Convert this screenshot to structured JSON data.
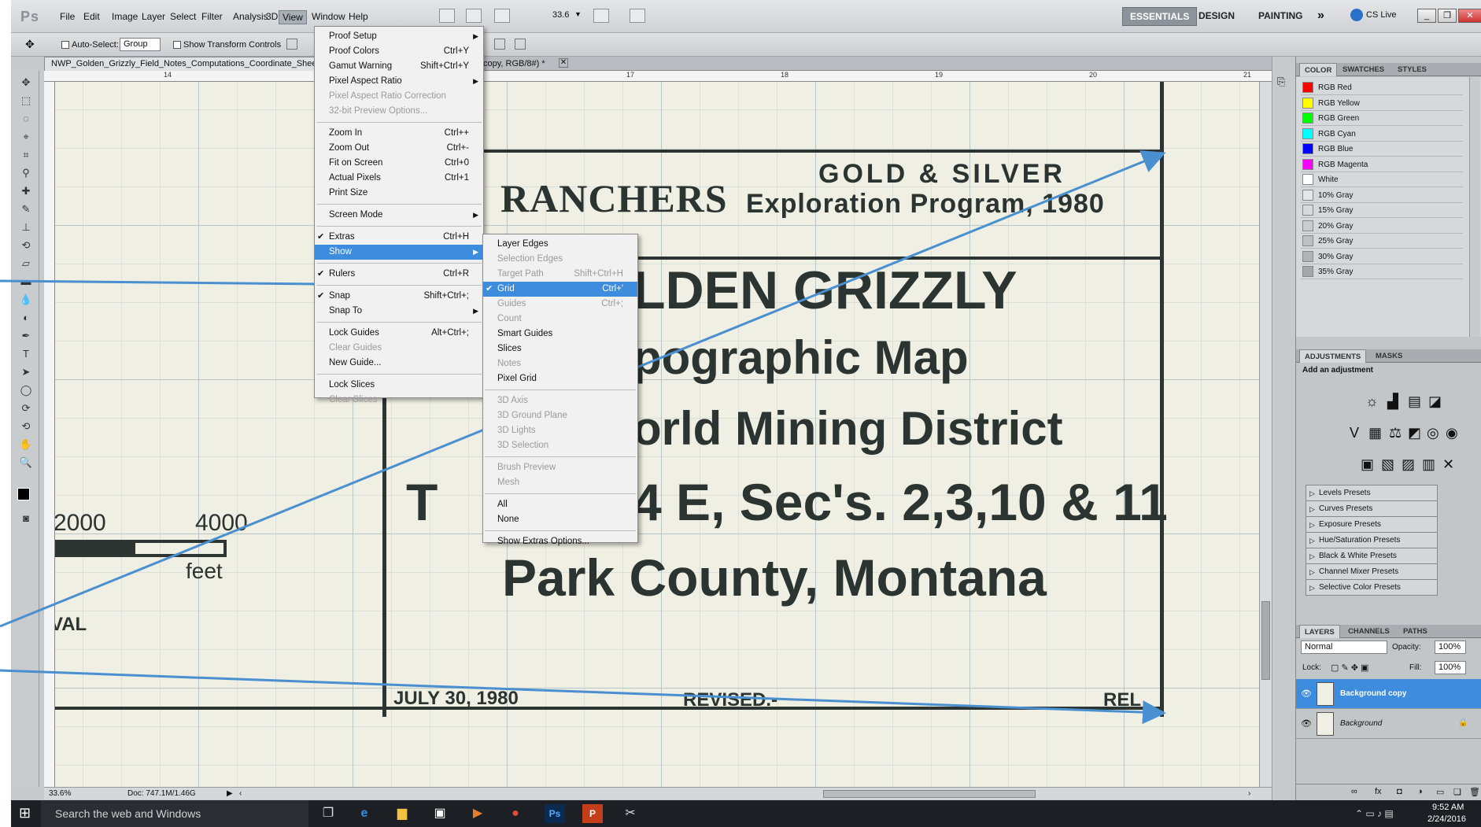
{
  "app": {
    "logo": "Ps"
  },
  "menubar": {
    "items": [
      "File",
      "Edit",
      "Image",
      "Layer",
      "Select",
      "Filter",
      "Analysis",
      "3D",
      "View",
      "Window",
      "Help"
    ],
    "zoom": "33.6",
    "workspaces": [
      "ESSENTIALS",
      "DESIGN",
      "PAINTING"
    ],
    "more": "»",
    "cslive": "CS Live"
  },
  "optionsbar": {
    "auto_select_label": "Auto-Select:",
    "auto_select_value": "Group",
    "show_transform": "Show Transform Controls"
  },
  "document": {
    "tab_title": "NWP_Golden_Grizzly_Field_Notes_Computations_Coordinate_Shee",
    "tab_suffix": "copy, RGB/8#) *",
    "ruler_numbers": [
      "14",
      "17",
      "18",
      "19",
      "20",
      "21"
    ],
    "map": {
      "gold_silver": "GOLD & SILVER",
      "ranchers": "RANCHERS",
      "exploration": "Exploration Program, 1980",
      "golden": "LDEN GRIZZLY",
      "topo": "pographic Map",
      "district": "orld Mining District",
      "sec": "4 E, Sec's. 2,3,10 & 11",
      "t": "T",
      "county": "Park County, Montana",
      "scale_2000": "2000",
      "scale_4000": "4000",
      "feet": "feet",
      "val": "VAL",
      "date": "JULY 30, 1980",
      "revised": "REVISED.-",
      "rel": "REL"
    }
  },
  "status": {
    "zoom": "33.6%",
    "doc": "Doc: 747.1M/1.46G"
  },
  "view_menu": {
    "items": [
      {
        "label": "Proof Setup",
        "shortcut": "",
        "arrow": true
      },
      {
        "label": "Proof Colors",
        "shortcut": "Ctrl+Y"
      },
      {
        "label": "Gamut Warning",
        "shortcut": "Shift+Ctrl+Y"
      },
      {
        "label": "Pixel Aspect Ratio",
        "shortcut": "",
        "arrow": true
      },
      {
        "label": "Pixel Aspect Ratio Correction",
        "shortcut": "",
        "disabled": true
      },
      {
        "label": "32-bit Preview Options...",
        "shortcut": "",
        "disabled": true
      },
      {
        "sep": true
      },
      {
        "label": "Zoom In",
        "shortcut": "Ctrl++"
      },
      {
        "label": "Zoom Out",
        "shortcut": "Ctrl+-"
      },
      {
        "label": "Fit on Screen",
        "shortcut": "Ctrl+0"
      },
      {
        "label": "Actual Pixels",
        "shortcut": "Ctrl+1"
      },
      {
        "label": "Print Size",
        "shortcut": ""
      },
      {
        "sep": true
      },
      {
        "label": "Screen Mode",
        "shortcut": "",
        "arrow": true
      },
      {
        "sep": true
      },
      {
        "label": "Extras",
        "shortcut": "Ctrl+H",
        "checked": true
      },
      {
        "label": "Show",
        "shortcut": "",
        "arrow": true,
        "highlight": true
      },
      {
        "sep": true
      },
      {
        "label": "Rulers",
        "shortcut": "Ctrl+R",
        "checked": true
      },
      {
        "sep": true
      },
      {
        "label": "Snap",
        "shortcut": "Shift+Ctrl+;",
        "checked": true
      },
      {
        "label": "Snap To",
        "shortcut": "",
        "arrow": true
      },
      {
        "sep": true
      },
      {
        "label": "Lock Guides",
        "shortcut": "Alt+Ctrl+;"
      },
      {
        "label": "Clear Guides",
        "shortcut": "",
        "disabled": true
      },
      {
        "label": "New Guide...",
        "shortcut": ""
      },
      {
        "sep": true
      },
      {
        "label": "Lock Slices",
        "shortcut": ""
      },
      {
        "label": "Clear Slices",
        "shortcut": "",
        "disabled": true
      }
    ]
  },
  "show_menu": {
    "items": [
      {
        "label": "Layer Edges",
        "shortcut": ""
      },
      {
        "label": "Selection Edges",
        "shortcut": "",
        "disabled": true
      },
      {
        "label": "Target Path",
        "shortcut": "Shift+Ctrl+H",
        "disabled": true
      },
      {
        "label": "Grid",
        "shortcut": "Ctrl+'",
        "checked": true,
        "highlight": true
      },
      {
        "label": "Guides",
        "shortcut": "Ctrl+;",
        "disabled": true
      },
      {
        "label": "Count",
        "shortcut": "",
        "disabled": true
      },
      {
        "label": "Smart Guides",
        "shortcut": ""
      },
      {
        "label": "Slices",
        "shortcut": ""
      },
      {
        "label": "Notes",
        "shortcut": "",
        "disabled": true
      },
      {
        "label": "Pixel Grid",
        "shortcut": ""
      },
      {
        "sep": true
      },
      {
        "label": "3D Axis",
        "shortcut": "",
        "disabled": true
      },
      {
        "label": "3D Ground Plane",
        "shortcut": "",
        "disabled": true
      },
      {
        "label": "3D Lights",
        "shortcut": "",
        "disabled": true
      },
      {
        "label": "3D Selection",
        "shortcut": "",
        "disabled": true
      },
      {
        "sep": true
      },
      {
        "label": "Brush Preview",
        "shortcut": "",
        "disabled": true
      },
      {
        "label": "Mesh",
        "shortcut": "",
        "disabled": true
      },
      {
        "sep": true
      },
      {
        "label": "All",
        "shortcut": ""
      },
      {
        "label": "None",
        "shortcut": ""
      },
      {
        "sep": true
      },
      {
        "label": "Show Extras Options...",
        "shortcut": ""
      }
    ]
  },
  "panels": {
    "color_tabs": [
      "COLOR",
      "SWATCHES",
      "STYLES"
    ],
    "swatches": [
      {
        "name": "RGB Red",
        "color": "#ff0000"
      },
      {
        "name": "RGB Yellow",
        "color": "#ffff00"
      },
      {
        "name": "RGB Green",
        "color": "#00ff00"
      },
      {
        "name": "RGB Cyan",
        "color": "#00ffff"
      },
      {
        "name": "RGB Blue",
        "color": "#0000ff"
      },
      {
        "name": "RGB Magenta",
        "color": "#ff00ff"
      },
      {
        "name": "White",
        "color": "#ffffff"
      },
      {
        "name": "10% Gray",
        "color": "#e6e6e6"
      },
      {
        "name": "15% Gray",
        "color": "#d9d9d9"
      },
      {
        "name": "20% Gray",
        "color": "#cccccc"
      },
      {
        "name": "25% Gray",
        "color": "#bfbfbf"
      },
      {
        "name": "30% Gray",
        "color": "#b3b3b3"
      },
      {
        "name": "35% Gray",
        "color": "#a6a6a6"
      }
    ],
    "adj_tabs": [
      "ADJUSTMENTS",
      "MASKS"
    ],
    "add_adjustment": "Add an adjustment",
    "presets": [
      "Levels Presets",
      "Curves Presets",
      "Exposure Presets",
      "Hue/Saturation Presets",
      "Black & White Presets",
      "Channel Mixer Presets",
      "Selective Color Presets"
    ],
    "layers_tabs": [
      "LAYERS",
      "CHANNELS",
      "PATHS"
    ],
    "blend": "Normal",
    "opacity_label": "Opacity:",
    "opacity": "100%",
    "lock_label": "Lock:",
    "fill_label": "Fill:",
    "fill": "100%",
    "layers": [
      {
        "name": "Background copy",
        "selected": true
      },
      {
        "name": "Background",
        "selected": false
      }
    ]
  },
  "taskbar": {
    "search": "Search the web and Windows",
    "time": "9:52 AM",
    "date": "2/24/2016"
  },
  "colors": {
    "accent": "#3d8cde",
    "arrow": "#4a90d0"
  }
}
